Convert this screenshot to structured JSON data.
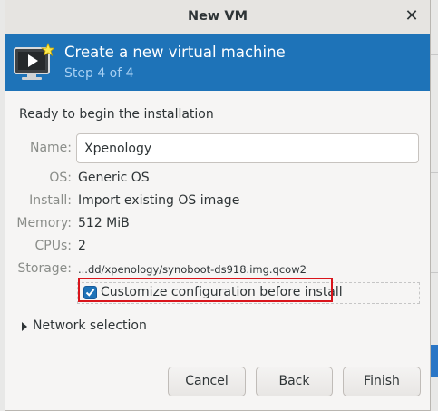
{
  "window": {
    "title": "New VM"
  },
  "banner": {
    "heading": "Create a new virtual machine",
    "step": "Step 4 of 4"
  },
  "summary": {
    "ready_text": "Ready to begin the installation",
    "name_label": "Name:",
    "name_value": "Xpenology",
    "os_label": "OS:",
    "os_value": "Generic OS",
    "install_label": "Install:",
    "install_value": "Import existing OS image",
    "memory_label": "Memory:",
    "memory_value": "512 MiB",
    "cpus_label": "CPUs:",
    "cpus_value": "2",
    "storage_label": "Storage:",
    "storage_value": "...dd/xpenology/synoboot-ds918.img.qcow2"
  },
  "customize": {
    "label": "Customize configuration before install",
    "checked": true
  },
  "network": {
    "label": "Network selection"
  },
  "buttons": {
    "cancel": "Cancel",
    "back": "Back",
    "finish": "Finish"
  },
  "colors": {
    "banner": "#1e73b8",
    "step_text": "#a8d0f3",
    "highlight": "#d9141b"
  }
}
